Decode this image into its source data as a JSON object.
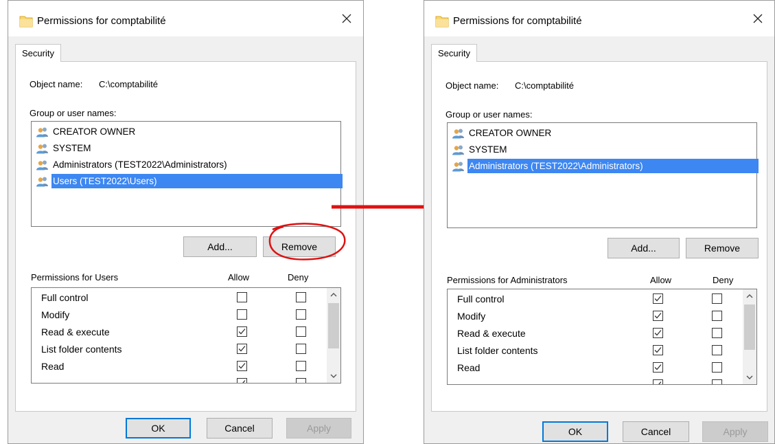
{
  "left": {
    "title": "Permissions for comptabilité",
    "tab_label": "Security",
    "object_label": "Object name:",
    "object_value": "C:\\comptabilité",
    "group_label": "Group or user names:",
    "users": [
      {
        "label": "CREATOR OWNER",
        "selected": false
      },
      {
        "label": "SYSTEM",
        "selected": false
      },
      {
        "label": "Administrators (TEST2022\\Administrators)",
        "selected": false
      },
      {
        "label": "Users (TEST2022\\Users)",
        "selected": true
      }
    ],
    "add_label": "Add...",
    "remove_label": "Remove",
    "permissions_for": "Permissions for Users",
    "allow_label": "Allow",
    "deny_label": "Deny",
    "permissions": [
      {
        "name": "Full control",
        "allow": false,
        "deny": false
      },
      {
        "name": "Modify",
        "allow": false,
        "deny": false
      },
      {
        "name": "Read & execute",
        "allow": true,
        "deny": false
      },
      {
        "name": "List folder contents",
        "allow": true,
        "deny": false
      },
      {
        "name": "Read",
        "allow": true,
        "deny": false
      },
      {
        "name": "",
        "allow": true,
        "deny": false
      }
    ],
    "ok_label": "OK",
    "cancel_label": "Cancel",
    "apply_label": "Apply"
  },
  "right": {
    "title": "Permissions for comptabilité",
    "tab_label": "Security",
    "object_label": "Object name:",
    "object_value": "C:\\comptabilité",
    "group_label": "Group or user names:",
    "users": [
      {
        "label": "CREATOR OWNER",
        "selected": false
      },
      {
        "label": "SYSTEM",
        "selected": false
      },
      {
        "label": "Administrators (TEST2022\\Administrators)",
        "selected": true
      }
    ],
    "add_label": "Add...",
    "remove_label": "Remove",
    "permissions_for": "Permissions for Administrators",
    "allow_label": "Allow",
    "deny_label": "Deny",
    "permissions": [
      {
        "name": "Full control",
        "allow": true,
        "deny": false
      },
      {
        "name": "Modify",
        "allow": true,
        "deny": false
      },
      {
        "name": "Read & execute",
        "allow": true,
        "deny": false
      },
      {
        "name": "List folder contents",
        "allow": true,
        "deny": false
      },
      {
        "name": "Read",
        "allow": true,
        "deny": false
      },
      {
        "name": "",
        "allow": true,
        "deny": false
      }
    ],
    "ok_label": "OK",
    "cancel_label": "Cancel",
    "apply_label": "Apply"
  },
  "colors": {
    "selection": "#3d87f2",
    "annotation_red": "#e01010",
    "ok_border": "#0078d7"
  },
  "icons": {
    "folder": "folder-icon",
    "close": "close-icon",
    "user_group": "users-group-icon",
    "checkmark": "checkmark-icon",
    "arrow": "arrow-right-icon"
  }
}
